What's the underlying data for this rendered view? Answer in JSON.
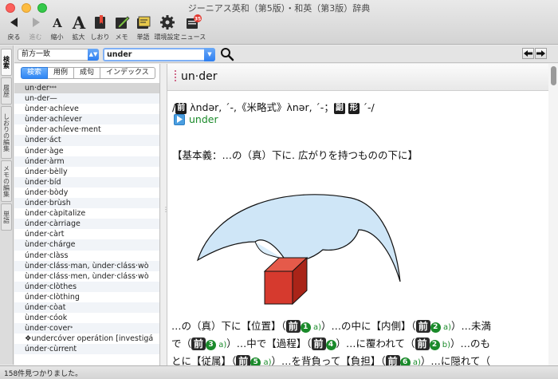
{
  "window": {
    "title": "ジーニアス英和（第5版）・和英（第3版）辞典"
  },
  "toolbar": {
    "items": [
      {
        "label": "戻る",
        "icon": "back-arrow-icon",
        "enabled": true
      },
      {
        "label": "進む",
        "icon": "forward-arrow-icon",
        "enabled": false
      },
      {
        "label": "縮小",
        "icon": "font-smaller-icon",
        "enabled": true
      },
      {
        "label": "拡大",
        "icon": "font-larger-icon",
        "enabled": true
      },
      {
        "label": "しおり",
        "icon": "bookmark-icon",
        "enabled": true
      },
      {
        "label": "メモ",
        "icon": "memo-icon",
        "enabled": true
      },
      {
        "label": "単語",
        "icon": "wordbook-icon",
        "enabled": true
      },
      {
        "label": "環境設定",
        "icon": "gear-icon",
        "enabled": true
      },
      {
        "label": "ニュース",
        "icon": "news-icon",
        "badge": "35",
        "enabled": true
      }
    ]
  },
  "side_tabs": [
    {
      "label": "検索",
      "active": true
    },
    {
      "label": "履歴",
      "active": false
    },
    {
      "label": "しおりの編集",
      "active": false
    },
    {
      "label": "メモの編集",
      "active": false
    },
    {
      "label": "単語",
      "active": false
    }
  ],
  "search": {
    "mode": "前方一致",
    "query": "under"
  },
  "list_tabs": [
    {
      "label": "検索",
      "active": true
    },
    {
      "label": "用例",
      "active": false
    },
    {
      "label": "成句",
      "active": false
    },
    {
      "label": "インデックス",
      "active": false
    }
  ],
  "results": [
    {
      "text": "un·der",
      "sup": "***",
      "selected": true
    },
    {
      "text": "un-der—",
      "sup": ""
    },
    {
      "text": "ùnder·achíeve",
      "sup": ""
    },
    {
      "text": "ùnder·achíever",
      "sup": ""
    },
    {
      "text": "ùnder·achíeve·ment",
      "sup": ""
    },
    {
      "text": "ùnder·áct",
      "sup": ""
    },
    {
      "text": "únder·àge",
      "sup": ""
    },
    {
      "text": "únder·àrm",
      "sup": ""
    },
    {
      "text": "únder·bèlly",
      "sup": ""
    },
    {
      "text": "ùnder·bíd",
      "sup": ""
    },
    {
      "text": "únder·bòdy",
      "sup": ""
    },
    {
      "text": "únder·brùsh",
      "sup": ""
    },
    {
      "text": "ùnder·càpitalize",
      "sup": ""
    },
    {
      "text": "únder·càrriage",
      "sup": ""
    },
    {
      "text": "únder·càrt",
      "sup": ""
    },
    {
      "text": "ùnder·chárge",
      "sup": ""
    },
    {
      "text": "únder·clàss",
      "sup": ""
    },
    {
      "text": "ùnder·cláss·man,  ùnder·cláss·wò",
      "sup": ""
    },
    {
      "text": "ùnder·cláss·men,  ùnder·cláss·wò",
      "sup": ""
    },
    {
      "text": "únder·clòthes",
      "sup": ""
    },
    {
      "text": "únder·clòthing",
      "sup": ""
    },
    {
      "text": "únder·còat",
      "sup": ""
    },
    {
      "text": "ùnder·cóok",
      "sup": ""
    },
    {
      "text": "ùnder·cover",
      "sup": "*"
    },
    {
      "text": "❖undercóver operátion  [investigá",
      "sup": ""
    },
    {
      "text": "únder·cùrrent",
      "sup": ""
    }
  ],
  "entry": {
    "headword": "un·der",
    "pron_prefix": "/",
    "pron_box1": "前",
    "pron_text1": " ʌ̀ndər, ´-,《米略式》ʌ̀nər, ´-；",
    "pron_box2": "副",
    "pron_box3": "形",
    "pron_text2": " ´-/",
    "audio_word": "under",
    "core_meaning": "【基本義：…の（真）下に. 広がりを持つものの下に】",
    "lines": [
      [
        {
          "t": "…の（真）下に【位置】（"
        },
        {
          "pos": "前"
        },
        {
          "num": "1"
        },
        {
          "sub": " a)"
        },
        {
          "t": "）…の中に【内側】（"
        },
        {
          "pos": "前"
        },
        {
          "num": "2"
        },
        {
          "sub": " a)"
        },
        {
          "t": "）…未満"
        }
      ],
      [
        {
          "t": "で（"
        },
        {
          "pos": "前"
        },
        {
          "num": "3"
        },
        {
          "sub": " a)"
        },
        {
          "t": "）…中で【過程】（"
        },
        {
          "pos": "前"
        },
        {
          "num": "4"
        },
        {
          "t": "）…に覆われて（"
        },
        {
          "pos": "前"
        },
        {
          "num": "2"
        },
        {
          "sub": " b)"
        },
        {
          "t": "）…のも"
        }
      ],
      [
        {
          "t": "とに【従属】（"
        },
        {
          "pos": "前"
        },
        {
          "num": "5"
        },
        {
          "sub": " a)"
        },
        {
          "t": "）…を背負って【負担】（"
        },
        {
          "pos": "前"
        },
        {
          "num": "6"
        },
        {
          "sub": " a)"
        },
        {
          "t": "）…に隠れて（"
        }
      ]
    ]
  },
  "status": {
    "text": "158件見つかりました。"
  },
  "colors": {
    "accent": "#2f86f5",
    "sense_number": "#1a8a2a",
    "cube_red": "#d63a2e",
    "canopy_blue": "#cfe6f7"
  }
}
